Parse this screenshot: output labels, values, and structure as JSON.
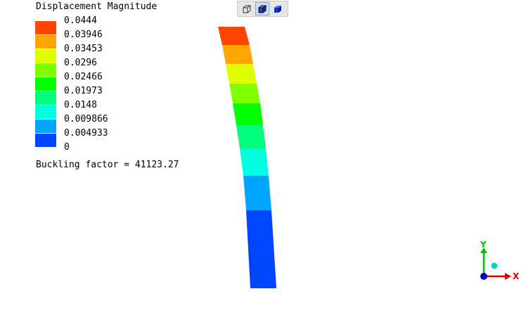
{
  "legend": {
    "title": "Displacement Magnitude",
    "colors": [
      "#ff4500",
      "#ffa500",
      "#dfff00",
      "#7fff00",
      "#00ff00",
      "#00ff7f",
      "#00ffdf",
      "#00a5ff",
      "#0045ff"
    ],
    "labels": [
      "0.0444",
      "0.03946",
      "0.03453",
      "0.0296",
      "0.02466",
      "0.01973",
      "0.0148",
      "0.009866",
      "0.004933",
      "0"
    ]
  },
  "buckling_factor_text": "Buckling factor = 41123.27",
  "view_toolbar": {
    "buttons": [
      {
        "name": "wireframe-view-icon",
        "active": false
      },
      {
        "name": "shaded-edges-view-icon",
        "active": true
      },
      {
        "name": "solid-view-icon",
        "active": false
      }
    ]
  },
  "axes": {
    "x_label": "X",
    "y_label": "Y",
    "x_color": "#e00000",
    "y_color": "#00c000",
    "z_color": "#0000d0",
    "marker_color": "#00d0d0"
  }
}
